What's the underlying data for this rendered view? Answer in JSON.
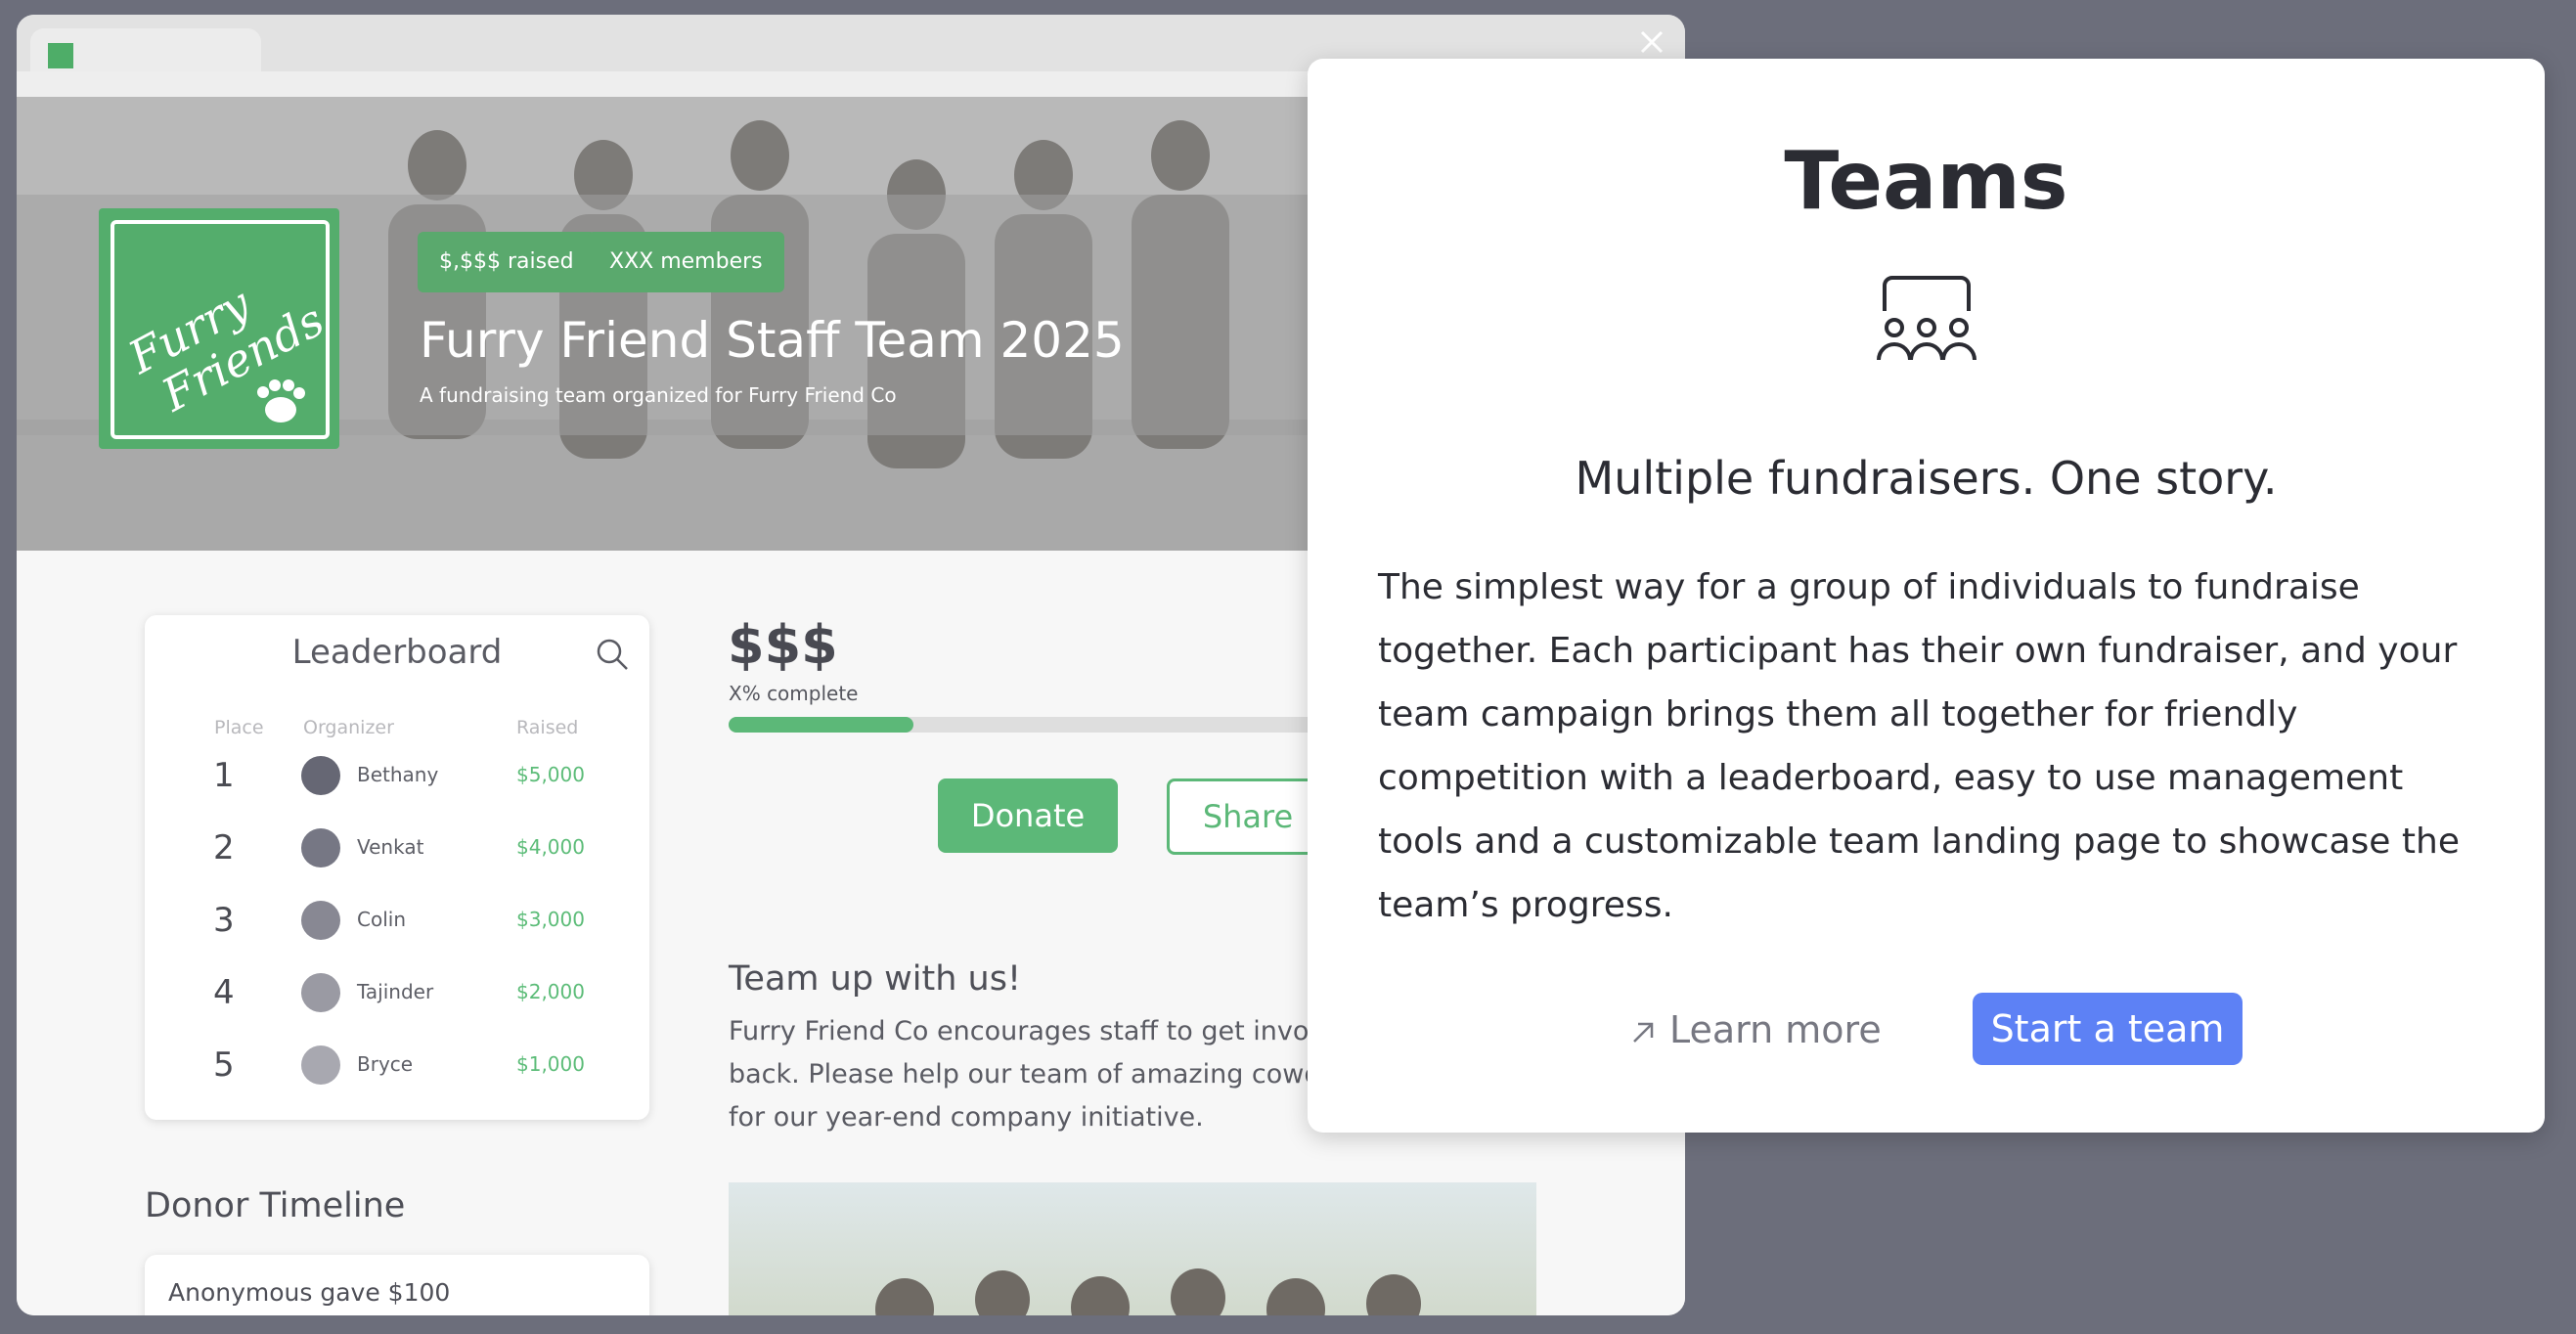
{
  "browser": {
    "hero": {
      "badges": [
        "$,$$$ raised",
        "XXX members"
      ],
      "title": "Furry Friend Staff Team 2025",
      "subtitle": "A fundraising team organized for Furry Friend Co",
      "logo_text": "Furry Friends"
    },
    "leaderboard": {
      "title": "Leaderboard",
      "headers": {
        "place": "Place",
        "organizer": "Organizer",
        "raised": "Raised"
      },
      "rows": [
        {
          "place": "1",
          "name": "Bethany",
          "raised": "$5,000",
          "avatar_color": "#666774"
        },
        {
          "place": "2",
          "name": "Venkat",
          "raised": "$4,000",
          "avatar_color": "#767784"
        },
        {
          "place": "3",
          "name": "Colin",
          "raised": "$3,000",
          "avatar_color": "#888893"
        },
        {
          "place": "4",
          "name": "Tajinder",
          "raised": "$2,000",
          "avatar_color": "#9a9aa3"
        },
        {
          "place": "5",
          "name": "Bryce",
          "raised": "$1,000",
          "avatar_color": "#a8a8b0"
        }
      ]
    },
    "campaign": {
      "amount": "$$$",
      "complete_label": "X% complete",
      "progress": 0.21,
      "donate_label": "Donate",
      "share_label": "Share",
      "team_heading": "Team up with us!",
      "team_text": "Furry Friend Co encourages staff to get involv back. Please help our team of amazing cowor for our year-end company initiative."
    },
    "donor_timeline": {
      "heading": "Donor Timeline",
      "first_entry": "Anonymous gave $100"
    }
  },
  "modal": {
    "title": "Teams",
    "icon": "team-group-icon",
    "subtitle": "Multiple fundraisers. One story.",
    "body": "The simplest way for a group of individuals to fundraise together. Each participant has their own fundraiser, and your team campaign brings them all together for friendly competition with a leaderboard, easy to use management tools and a customizable team landing page to showcase the team’s progress.",
    "learn_more_label": "Learn more",
    "start_team_label": "Start a team"
  },
  "colors": {
    "brand_green": "#5cb878",
    "primary_blue": "#5d81f5",
    "backdrop": "#6c6e7b"
  }
}
